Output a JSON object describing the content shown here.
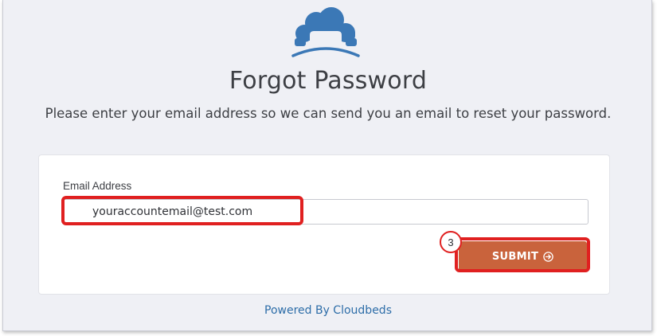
{
  "logo": {
    "icon": "cloudbeds-cloud-logo-icon",
    "color": "#3b78b6"
  },
  "page": {
    "title": "Forgot Password",
    "subtitle": "Please enter your email address so we can send you an email to reset your password."
  },
  "form": {
    "email_label": "Email Address",
    "email_value": "youraccountemail@test.com",
    "submit_label": "SUBMIT",
    "submit_icon": "arrow-circle-right-icon",
    "submit_color": "#c9633c"
  },
  "annotation": {
    "step_number": "3",
    "highlight_color": "#e02020"
  },
  "footer": {
    "powered_by": "Powered By Cloudbeds",
    "link_color": "#2d6da8"
  }
}
